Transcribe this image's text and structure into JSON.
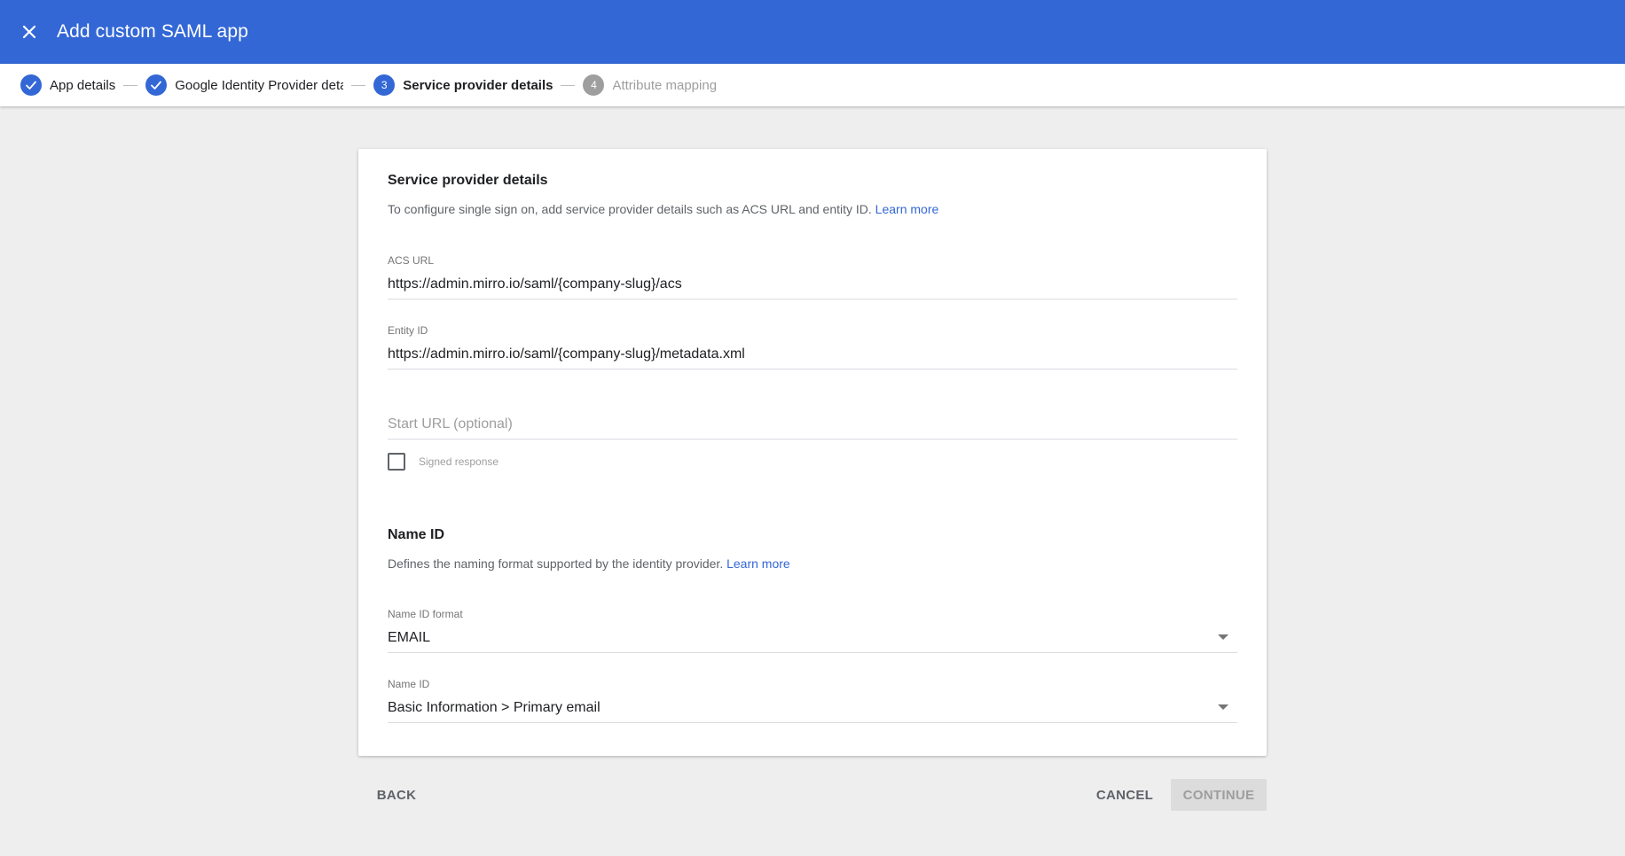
{
  "header": {
    "title": "Add custom SAML app",
    "close_icon": "close-icon",
    "bg_color": "#3367d6"
  },
  "stepper": {
    "steps": [
      {
        "label": "App details",
        "state": "done",
        "marker": "✓"
      },
      {
        "label": "Google Identity Provider details",
        "state": "done",
        "marker": "✓"
      },
      {
        "label": "Service provider details",
        "state": "active",
        "marker": "3"
      },
      {
        "label": "Attribute mapping",
        "state": "pending",
        "marker": "4"
      }
    ]
  },
  "service_provider": {
    "title": "Service provider details",
    "description": "To configure single sign on, add service provider details such as ACS URL and entity ID.",
    "learn_more": "Learn more",
    "acs_url": {
      "label": "ACS URL",
      "value": "https://admin.mirro.io/saml/{company-slug}/acs"
    },
    "entity_id": {
      "label": "Entity ID",
      "value": "https://admin.mirro.io/saml/{company-slug}/metadata.xml"
    },
    "start_url": {
      "placeholder": "Start URL (optional)",
      "value": ""
    },
    "signed_response": {
      "label": "Signed response",
      "checked": false
    }
  },
  "name_id": {
    "title": "Name ID",
    "description": "Defines the naming format supported by the identity provider.",
    "learn_more": "Learn more",
    "format": {
      "label": "Name ID format",
      "value": "EMAIL"
    },
    "name_id_field": {
      "label": "Name ID",
      "value": "Basic Information > Primary email"
    }
  },
  "footer": {
    "back_label": "BACK",
    "cancel_label": "CANCEL",
    "continue_label": "CONTINUE"
  }
}
